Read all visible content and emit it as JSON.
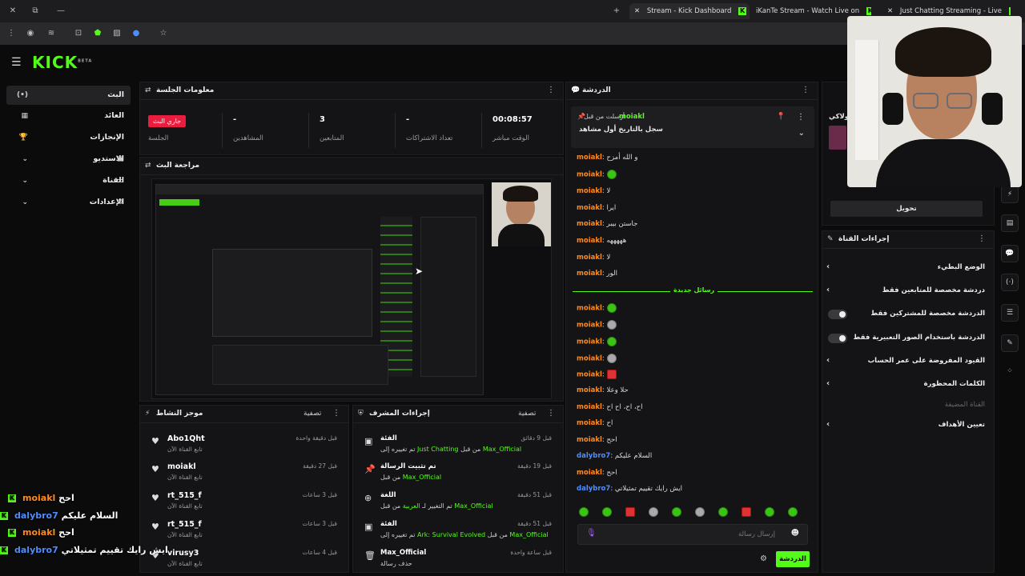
{
  "browser": {
    "tabs": [
      {
        "title": "Stream - Kick Dashboard",
        "active": true
      },
      {
        "title": "iKanTe Stream - Watch Live on",
        "active": false
      },
      {
        "title": "Just Chatting Streaming - Live",
        "active": false
      }
    ],
    "new_tab": "+",
    "tab_close": "✕"
  },
  "app": {
    "logo": "KICK",
    "logo_sup": "BETA"
  },
  "nav": [
    {
      "label": "البث",
      "icon": "(•)",
      "active": true
    },
    {
      "label": "العائد",
      "icon": "▦"
    },
    {
      "label": "الإنجازات",
      "icon": "🏆"
    },
    {
      "label": "الاستديو",
      "icon": "▣",
      "chevron": true
    },
    {
      "label": "القناة",
      "icon": "⚏",
      "chevron": true
    },
    {
      "label": "الإعدادات",
      "icon": "⚙",
      "chevron": true
    }
  ],
  "session": {
    "title": "معلومات الجلسة",
    "stats": [
      {
        "value": "00:08:57",
        "label": "الوقت مباشر"
      },
      {
        "value": "-",
        "label": "تعداد الاشتراكات"
      },
      {
        "value": "3",
        "label": "المتابعين"
      },
      {
        "value": "-",
        "label": "المشاهدين"
      },
      {
        "badge": "جاري البث",
        "label": "الجلسة"
      }
    ]
  },
  "preview": {
    "title": "مراجعة البث"
  },
  "activity": {
    "title": "موجز النشاط",
    "filter": "تصفية",
    "items": [
      {
        "name": "Abo1Qht",
        "sub": "تابع القناة الآن",
        "time": "قبل دقيقة واحدة"
      },
      {
        "name": "moiakl",
        "sub": "تابع القناة الآن",
        "time": "قبل 27 دقيقة"
      },
      {
        "name": "rt_515_f",
        "sub": "تابع القناة الآن",
        "time": "قبل 3 ساعات"
      },
      {
        "name": "rt_515_f",
        "sub": "تابع القناة الآن",
        "time": "قبل 3 ساعات"
      },
      {
        "name": "virusy3",
        "sub": "تابع القناة الآن",
        "time": "قبل 4 ساعات"
      }
    ]
  },
  "mod": {
    "title": "إجراءات المشرف",
    "filter": "تصفية",
    "items": [
      {
        "name": "الفئة",
        "sub_pre": "تم تغييره إلى ",
        "sub_g": "Just Chatting",
        "sub_mid": " من قبل ",
        "sub_user": "Max_Official",
        "time": "قبل 9 دقائق",
        "icon": "▣"
      },
      {
        "name": "تم تثبيت الرسالة",
        "sub_pre": "من قبل ",
        "sub_g": "",
        "sub_mid": "",
        "sub_user": "Max_Official",
        "time": "قبل 19 دقيقة",
        "icon": "📌"
      },
      {
        "name": "اللغة",
        "sub_pre": "تم التغيير لـ ",
        "sub_g": "العربية",
        "sub_mid": " من قبل ",
        "sub_user": "Max_Official",
        "time": "قبل 51 دقيقة",
        "icon": "⊕"
      },
      {
        "name": "الفئة",
        "sub_pre": "تم تغييره إلى ",
        "sub_g": "Ark: Survival Evolved",
        "sub_mid": " من قبل ",
        "sub_user": "Max_Official",
        "time": "قبل 51 دقيقة",
        "icon": "▣"
      },
      {
        "name": "Max_Official",
        "sub_pre": "حذف رسالة",
        "sub_g": "",
        "sub_mid": "",
        "sub_user": "",
        "time": "قبل ساعة واحدة",
        "icon": "🗑"
      }
    ]
  },
  "chat": {
    "title": "الدردشة",
    "pinned_user": "moiakl",
    "pinned_by": "أرسلت من قبل",
    "pinned_text": "سجل بالتاريخ أول مشاهد",
    "new_messages": "رسائل جديدة",
    "messages": [
      {
        "user": "moiakl",
        "text": "و الله أمزح",
        "color": "#ff8a1c"
      },
      {
        "user": "moiakl",
        "emote": "green",
        "color": "#ff8a1c"
      },
      {
        "user": "moiakl",
        "text": "لا",
        "color": "#ff8a1c"
      },
      {
        "user": "moiakl",
        "text": "ايرا",
        "color": "#ff8a1c"
      },
      {
        "user": "moiakl",
        "text": "جاستن بيبر",
        "color": "#ff8a1c"
      },
      {
        "user": "moiakl",
        "text": "هههههه",
        "color": "#ff8a1c"
      },
      {
        "user": "moiakl",
        "text": "لا",
        "color": "#ff8a1c"
      },
      {
        "user": "moiakl",
        "text": "الور",
        "color": "#ff8a1c"
      },
      {
        "user": "moiakl",
        "emote": "green",
        "color": "#ff8a1c"
      },
      {
        "user": "moiakl",
        "emote": "gray",
        "color": "#ff8a1c"
      },
      {
        "user": "moiakl",
        "emote": "green",
        "color": "#ff8a1c"
      },
      {
        "user": "moiakl",
        "emote": "gray",
        "color": "#ff8a1c"
      },
      {
        "user": "moiakl",
        "emote": "red",
        "color": "#ff8a1c"
      },
      {
        "user": "moiakl",
        "text": "حلا وعلا",
        "color": "#ff8a1c"
      },
      {
        "user": "moiakl",
        "text": "اح، اح، اح اح",
        "color": "#ff8a1c"
      },
      {
        "user": "moiakl",
        "text": "اح",
        "color": "#ff8a1c"
      },
      {
        "user": "moiakl",
        "text": "احح",
        "color": "#ff8a1c"
      },
      {
        "user": "dalybro7",
        "text": "السلام عليكم",
        "color": "#4f8dff"
      },
      {
        "user": "moiakl",
        "text": "احح",
        "color": "#ff8a1c"
      },
      {
        "user": "dalybro7",
        "text": "ايش رايك تقييم تمثيلاتي",
        "color": "#4f8dff"
      }
    ],
    "input_placeholder": "إرسال رسالة",
    "send_button": "الدردشة"
  },
  "channel": {
    "title": "إجراءات القناة",
    "top_button": "تحويل",
    "settings": [
      {
        "label": "الوضع البطيء",
        "type": "chev"
      },
      {
        "label": "دردشة مخصصة للمتابعين فقط",
        "type": "chev"
      },
      {
        "label": "الدردشة مخصصة للمشتركين فقط",
        "type": "toggle"
      },
      {
        "label": "الدردشة باستخدام الصور التعبيرية فقط",
        "type": "toggle"
      },
      {
        "label": "القيود المفروضة على عمر الحساب",
        "type": "chev"
      },
      {
        "label": "الكلمات المحظورة",
        "type": "chev"
      },
      {
        "label": "القناة المضيفة",
        "type": "muted"
      },
      {
        "label": "تعيين الأهداف",
        "type": "chev"
      }
    ],
    "side_partial": "ولاكي"
  },
  "overlay_chat": [
    {
      "user": "moiakl",
      "text": "احح",
      "color": "#ff8a1c"
    },
    {
      "user": "dalybro7",
      "text": "السلام عليكم",
      "color": "#4f8dff"
    },
    {
      "user": "moiakl",
      "text": "احح",
      "color": "#ff8a1c"
    },
    {
      "user": "dalybro7",
      "text": "ايش رايك تقييم تمثيلاتي",
      "color": "#4f8dff"
    }
  ]
}
